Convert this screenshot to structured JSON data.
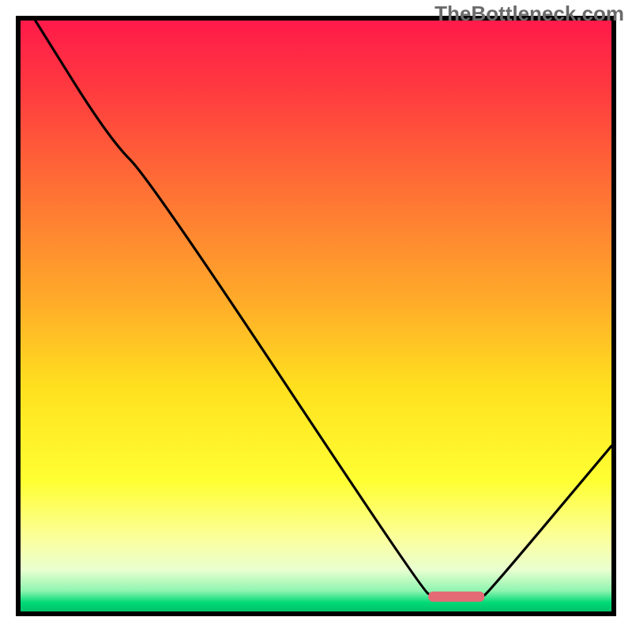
{
  "watermark": "TheBottleneck.com",
  "chart_data": {
    "type": "line",
    "title": "",
    "xlabel": "",
    "ylabel": "",
    "xrange": [
      0,
      100
    ],
    "yrange": [
      0,
      100
    ],
    "series": [
      {
        "name": "curve",
        "points": [
          {
            "x": 2.5,
            "y": 100
          },
          {
            "x": 15,
            "y": 80
          },
          {
            "x": 22,
            "y": 73
          },
          {
            "x": 68,
            "y": 3.5
          },
          {
            "x": 70,
            "y": 2.5
          },
          {
            "x": 78,
            "y": 2.5
          },
          {
            "x": 79,
            "y": 3
          },
          {
            "x": 100,
            "y": 28
          }
        ]
      }
    ],
    "marker": {
      "x_start": 69,
      "x_end": 78.5,
      "y": 2.5,
      "color": "#e46a76"
    },
    "background_gradient": {
      "stops": [
        {
          "offset": 0.0,
          "color": "#ff1a4a"
        },
        {
          "offset": 0.12,
          "color": "#ff3b3f"
        },
        {
          "offset": 0.3,
          "color": "#ff7534"
        },
        {
          "offset": 0.48,
          "color": "#ffad29"
        },
        {
          "offset": 0.62,
          "color": "#ffe01f"
        },
        {
          "offset": 0.78,
          "color": "#ffff33"
        },
        {
          "offset": 0.88,
          "color": "#fbffa0"
        },
        {
          "offset": 0.93,
          "color": "#e8ffd0"
        },
        {
          "offset": 0.965,
          "color": "#8ff5b0"
        },
        {
          "offset": 0.985,
          "color": "#00d977"
        },
        {
          "offset": 1.0,
          "color": "#00c26a"
        }
      ]
    },
    "frame": {
      "outer_margin": 20,
      "border_color": "#000000",
      "border_width": 6
    }
  }
}
